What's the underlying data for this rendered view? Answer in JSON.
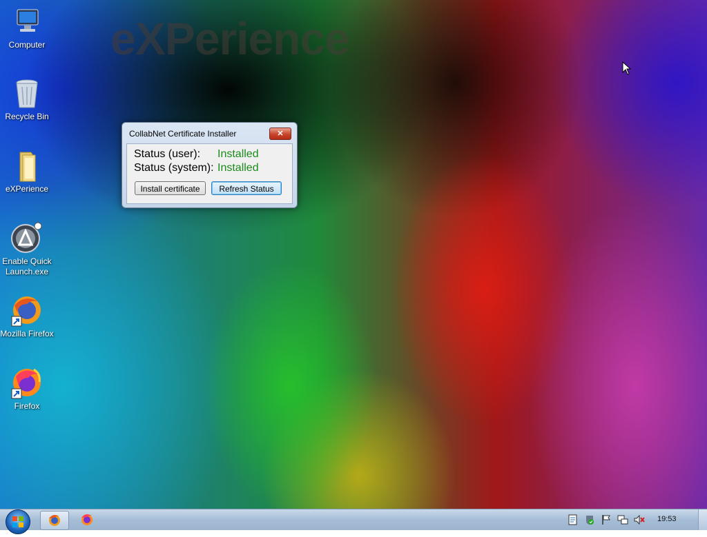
{
  "desktop": {
    "watermark": "eXPerience",
    "icons": [
      {
        "label": "Computer",
        "icon": "computer-icon"
      },
      {
        "label": "Recycle Bin",
        "icon": "recycle-bin-icon"
      },
      {
        "label": "eXPerience",
        "icon": "folder-icon"
      },
      {
        "label": "Enable Quick Launch.exe",
        "icon": "quick-launch-app-icon"
      },
      {
        "label": "Mozilla Firefox",
        "icon": "firefox-icon"
      },
      {
        "label": "Firefox",
        "icon": "firefox-icon"
      }
    ]
  },
  "dialog": {
    "title": "CollabNet Certificate Installer",
    "close_label": "✕",
    "user_status_label": "Status (user):",
    "user_status_value": "Installed",
    "system_status_label": "Status (system):",
    "system_status_value": "Installed",
    "install_button": "Install certificate",
    "refresh_button": "Refresh Status",
    "status_color": "#1a8a1a"
  },
  "taskbar": {
    "start_icon": "windows-start-icon",
    "buttons": [
      "firefox-icon",
      "firefox-icon"
    ],
    "tray_icons": [
      "action-center-icon",
      "security-shield-icon",
      "flag-icon",
      "network-icon",
      "volume-muted-icon"
    ],
    "clock": "19:53"
  }
}
